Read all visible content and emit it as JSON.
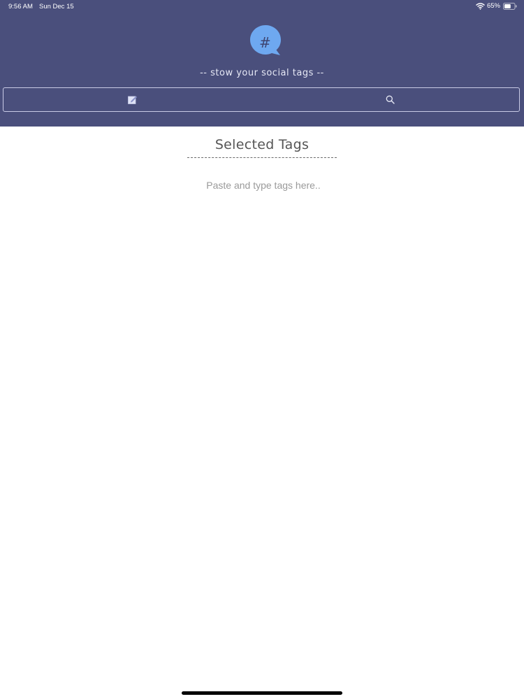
{
  "status_bar": {
    "time": "9:56 AM",
    "date": "Sun Dec 15",
    "battery": "65%",
    "battery_level": 0.65
  },
  "header": {
    "logo_icon": "hashtag-speech-bubble-icon",
    "tagline": "-- stow your social tags --",
    "tabs": [
      {
        "icon": "compose-icon"
      },
      {
        "icon": "search-icon"
      }
    ]
  },
  "main": {
    "title": "Selected Tags",
    "input_placeholder": "Paste and type tags here..",
    "input_value": ""
  },
  "colors": {
    "header_bg": "#4a4f7c",
    "logo_blue": "#6ea8f0",
    "text_muted": "#9a9a9a"
  }
}
